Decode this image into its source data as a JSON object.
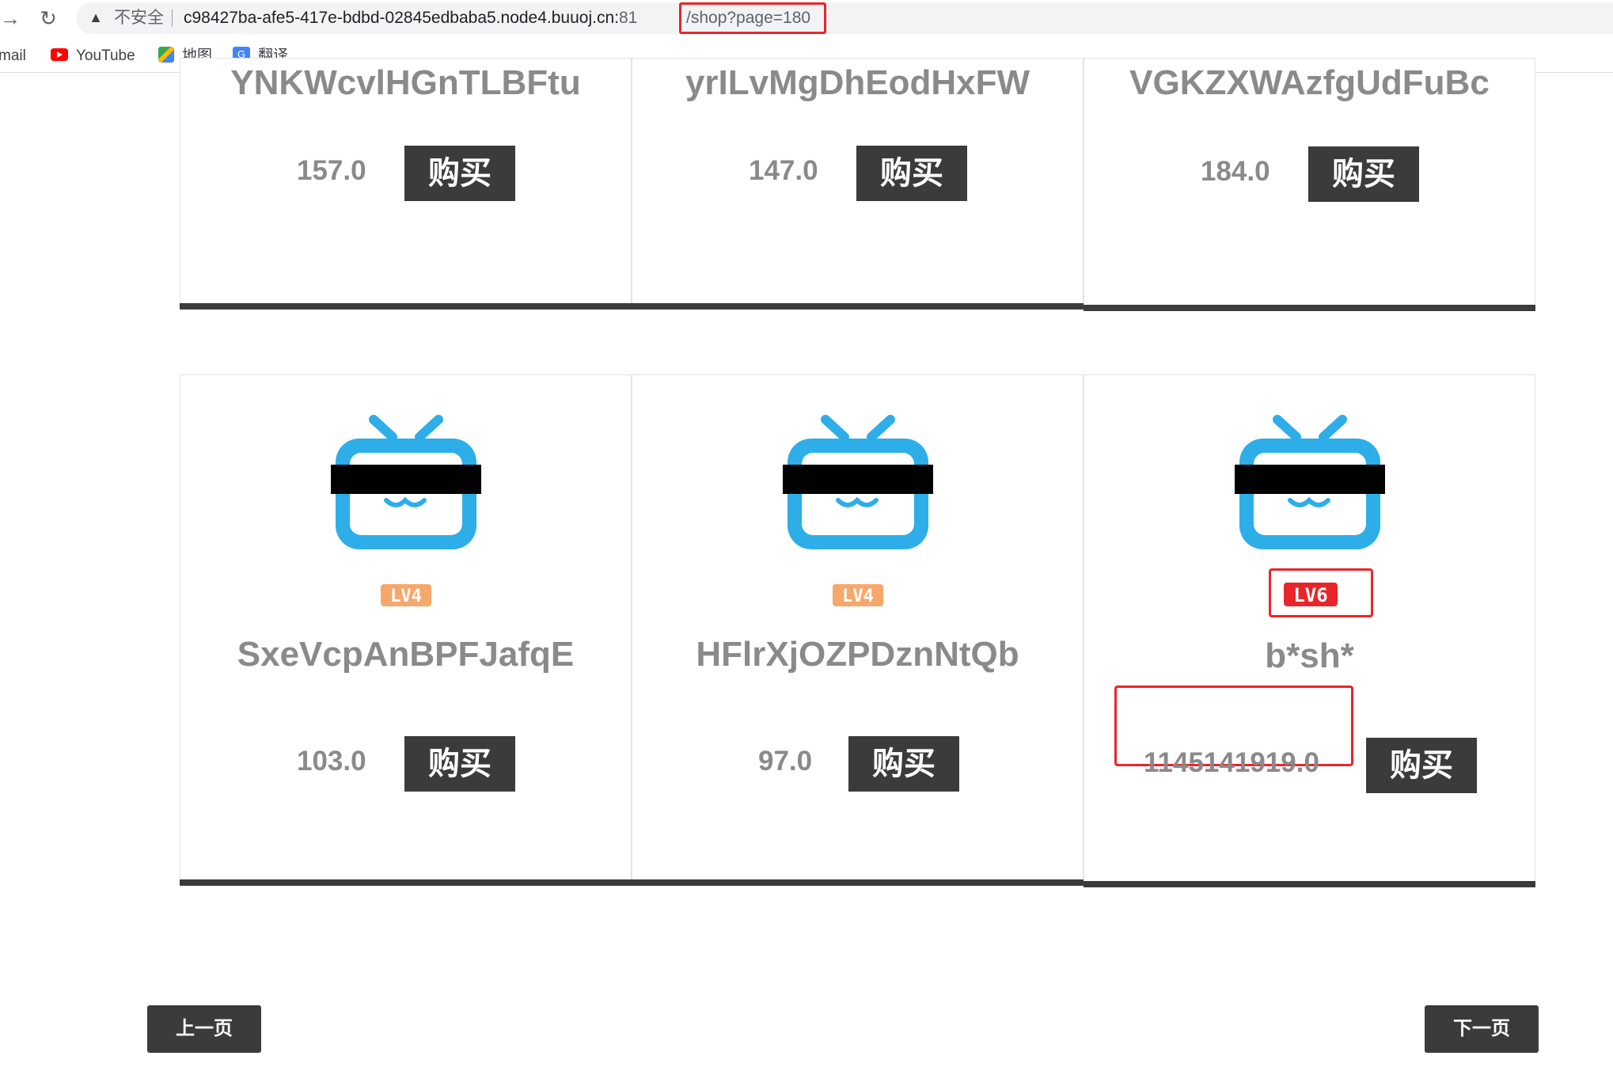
{
  "browser": {
    "insecure_label": "不安全",
    "host": "c98427ba-afe5-417e-bdbd-02845edbaba5.node4.buuoj.cn:",
    "port": "81",
    "path": "/shop?page=180",
    "bookmarks": [
      "mail",
      "YouTube",
      "地图",
      "翻译"
    ]
  },
  "top_row": [
    {
      "name": "YNKWcvlHGnTLBFtu",
      "price": "157.0",
      "buy": "购买"
    },
    {
      "name": "yrILvMgDhEodHxFW",
      "price": "147.0",
      "buy": "购买"
    },
    {
      "name": "VGKZXWAzfgUdFuBc",
      "price": "184.0",
      "buy": "购买"
    }
  ],
  "bottom_row": [
    {
      "name": "SxeVcpAnBPFJafqE",
      "price": "103.0",
      "buy": "购买",
      "level": "LV4",
      "level_color": "#f6a86c"
    },
    {
      "name": "HFlrXjOZPDznNtQb",
      "price": "97.0",
      "buy": "购买",
      "level": "LV4",
      "level_color": "#f6a86c"
    },
    {
      "name": "b*sh*",
      "price": "1145141919.0",
      "buy": "购买",
      "level": "LV6",
      "level_color": "#e8262a"
    }
  ],
  "pagination": {
    "prev": "上一页",
    "next": "下一页"
  },
  "colors": {
    "accent": "#3b3b3b",
    "tv_blue": "#2eaee8",
    "highlight": "#e8262a"
  }
}
